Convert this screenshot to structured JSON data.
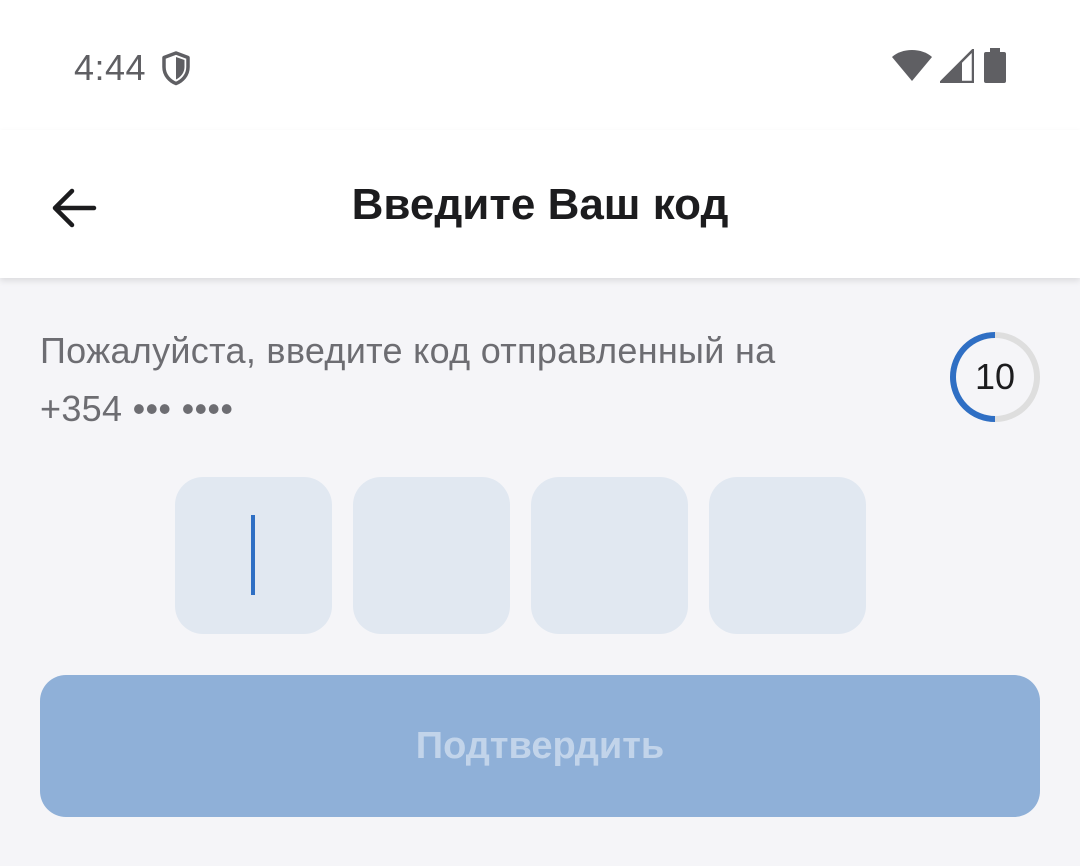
{
  "status_bar": {
    "time": "4:44",
    "icons": [
      "shield-icon",
      "wifi-icon",
      "signal-icon",
      "battery-icon"
    ]
  },
  "header": {
    "title": "Введите Ваш код",
    "back_icon": "arrow-left-icon"
  },
  "main": {
    "instruction": "Пожалуйста, введите код отправленный на",
    "phone_masked": "+354 ••• ••••",
    "countdown": "10",
    "code_cells": [
      "",
      "",
      "",
      ""
    ],
    "active_cell_index": 0,
    "confirm_label": "Подтвердить",
    "confirm_enabled": false
  },
  "colors": {
    "accent": "#2f6fc4",
    "cell_background": "#e1e8f1",
    "button_disabled": "#8fb0d8",
    "page_background": "#f5f5f8"
  }
}
